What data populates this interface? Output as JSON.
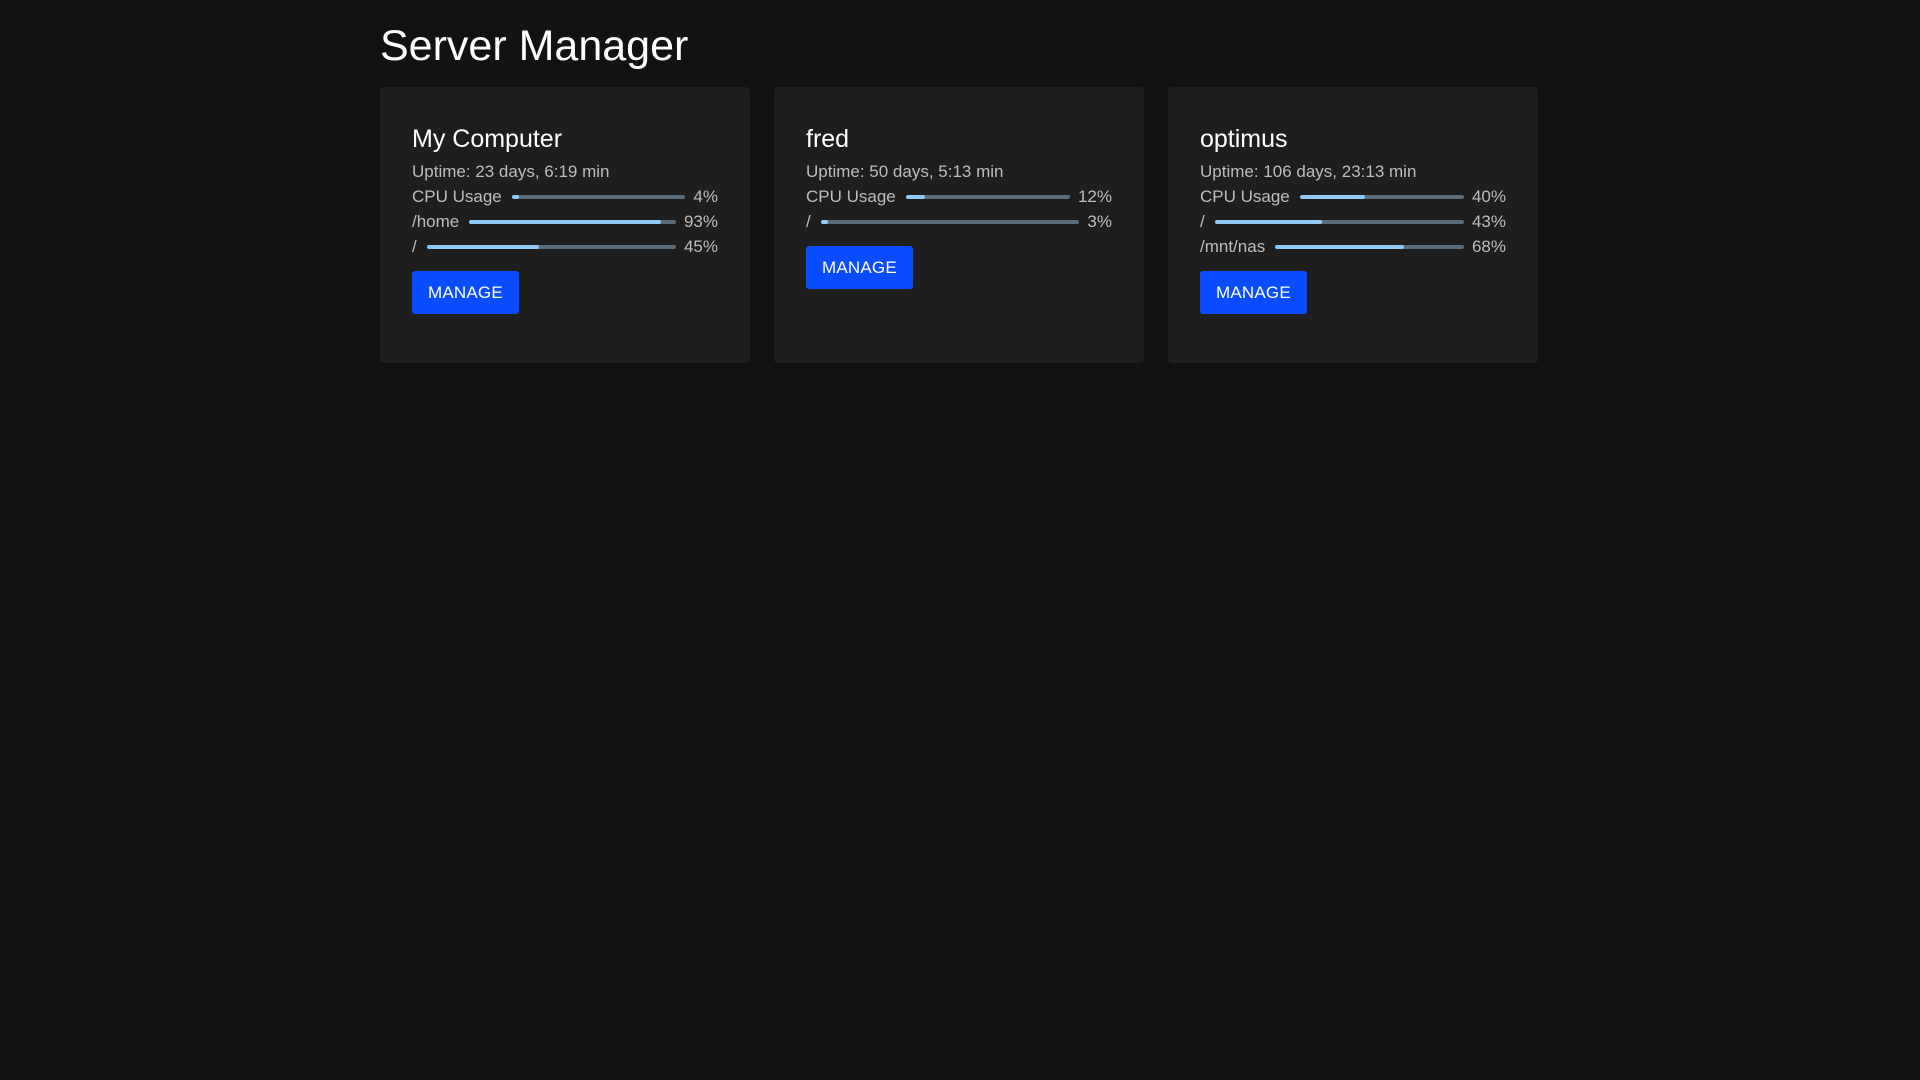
{
  "page": {
    "title": "Server Manager"
  },
  "colors": {
    "background": "#121212",
    "card": "#1e1e1e",
    "bar_track": "#5a6c7a",
    "bar_fill": "#90caf9",
    "button": "#0a4cff"
  },
  "servers": [
    {
      "name": "My Computer",
      "uptime": "Uptime: 23 days, 6:19 min",
      "metrics": [
        {
          "label": "CPU Usage",
          "value": "4%",
          "percent": 4
        },
        {
          "label": "/home",
          "value": "93%",
          "percent": 93
        },
        {
          "label": "/",
          "value": "45%",
          "percent": 45
        }
      ],
      "button_label": "MANAGE"
    },
    {
      "name": "fred",
      "uptime": "Uptime: 50 days, 5:13 min",
      "metrics": [
        {
          "label": "CPU Usage",
          "value": "12%",
          "percent": 12
        },
        {
          "label": "/",
          "value": "3%",
          "percent": 3
        }
      ],
      "button_label": "MANAGE"
    },
    {
      "name": "optimus",
      "uptime": "Uptime: 106 days, 23:13 min",
      "metrics": [
        {
          "label": "CPU Usage",
          "value": "40%",
          "percent": 40
        },
        {
          "label": "/",
          "value": "43%",
          "percent": 43
        },
        {
          "label": "/mnt/nas",
          "value": "68%",
          "percent": 68
        }
      ],
      "button_label": "MANAGE"
    }
  ]
}
